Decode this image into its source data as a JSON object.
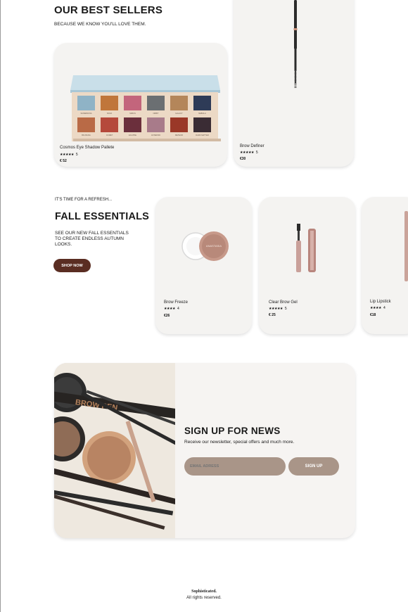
{
  "best_sellers": {
    "title": "OUR BEST SELLERS",
    "subtitle": "BECAUSE WE KNOW YOU'LL LOVE THEM.",
    "products": [
      {
        "name": "Cosmos Eye Shadow Pallete",
        "rating_stars": "★★★★★",
        "rating": "5",
        "price": "€ 52"
      },
      {
        "name": "Brow Definer",
        "rating_stars": "★★★★★",
        "rating": "5",
        "price": "€30"
      }
    ],
    "palette_swatches": [
      "#8fb3c6",
      "#c0763b",
      "#c3657c",
      "#6b6f72",
      "#b4865a",
      "#2e3b57",
      "#b96a46",
      "#b5493b",
      "#6b2f3c",
      "#a87b8a",
      "#9a3828",
      "#3a2c34"
    ],
    "palette_labels": [
      "SUPERNOVA",
      "NOVA",
      "SIRIUS",
      "ORBIT",
      "GALAXY",
      "NEBULA",
      "BIG BANG",
      "COMET",
      "ECLIPSE",
      "ASTEROID",
      "METEOR",
      "DARK MATTER"
    ]
  },
  "fall": {
    "kicker": "IT'S TIME FOR A REFRESH...",
    "title": "FALL ESSENTIALS",
    "body": "SEE OUR NEW FALL ESSENTIALS TO CREATE ENDLESS AUTUMN LOOKS.",
    "cta": "SHOP NOW",
    "products": [
      {
        "name": "Brow Freeze",
        "rating_stars": "★★★★",
        "rating": "4",
        "price": "€26"
      },
      {
        "name": "Clear Brow Gel",
        "rating_stars": "★★★★★",
        "rating": "5",
        "price": "€ 25"
      },
      {
        "name": "Lip Lipstick",
        "rating_stars": "★★★★",
        "rating": "4",
        "price": "€18"
      }
    ]
  },
  "newsletter": {
    "title": "SIGN UP FOR NEWS",
    "subtitle": "Receive our newsletter, special offers and much more.",
    "email_placeholder": "EMAIL ADRESS",
    "button": "SIGN UP",
    "image_label": "BROW PEN"
  },
  "footer": {
    "brand": "Sophisticated.",
    "rights": "All rights reserved."
  },
  "colors": {
    "accent_brown": "#5a2d22",
    "taupe": "#a99588",
    "card_bg": "#f4f3f1"
  }
}
